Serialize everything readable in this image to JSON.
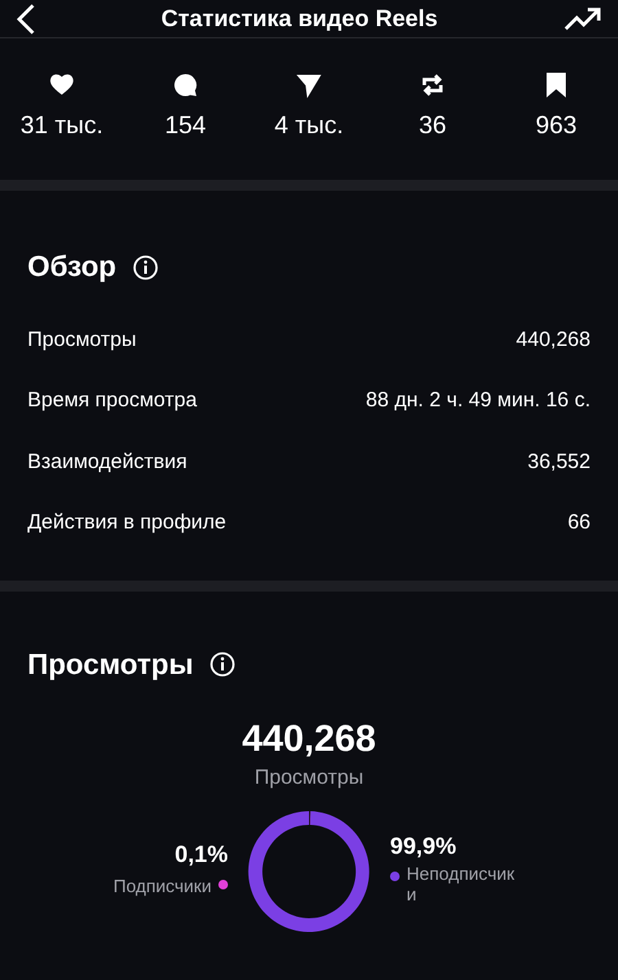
{
  "header": {
    "title": "Статистика видео Reels"
  },
  "stats": [
    {
      "kind": "likes",
      "value": "31 тыс."
    },
    {
      "kind": "comments",
      "value": "154"
    },
    {
      "kind": "shares",
      "value": "4 тыс."
    },
    {
      "kind": "reposts",
      "value": "36"
    },
    {
      "kind": "saves",
      "value": "963"
    }
  ],
  "overview": {
    "title": "Обзор",
    "rows": [
      {
        "label": "Просмотры",
        "value": "440,268"
      },
      {
        "label": "Время просмотра",
        "value": "88 дн. 2 ч. 49 мин. 16 с."
      },
      {
        "label": "Взаимодействия",
        "value": "36,552"
      },
      {
        "label": "Действия в профиле",
        "value": "66"
      }
    ]
  },
  "views": {
    "title": "Просмотры",
    "total": "440,268",
    "total_label": "Просмотры",
    "legend": [
      {
        "percent": "0,1%",
        "color": "#e040d8"
      },
      {
        "percent": "99,9%",
        "color": "#7b3fe4"
      }
    ],
    "chart_data": {
      "type": "donut",
      "categories": [
        "Подписчики",
        "Неподписчики"
      ],
      "values": [
        0.1,
        99.9
      ]
    }
  }
}
